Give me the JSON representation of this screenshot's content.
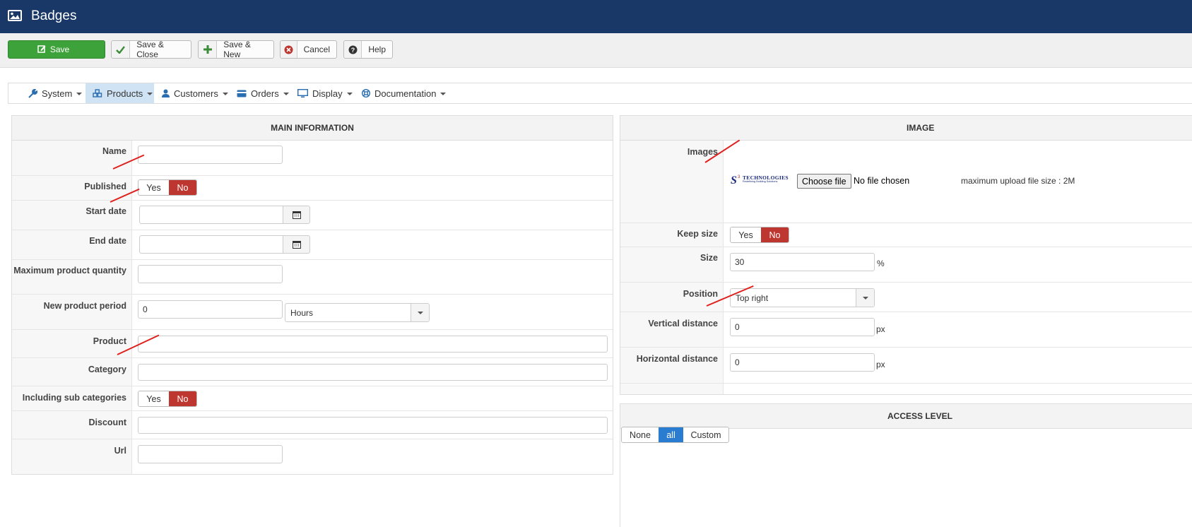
{
  "header": {
    "title": "Badges",
    "icon": "image-icon"
  },
  "toolbar": {
    "save": "Save",
    "save_close": "Save & Close",
    "save_new": "Save & New",
    "cancel": "Cancel",
    "help": "Help"
  },
  "menu": [
    {
      "label": "System",
      "icon": "wrench-icon"
    },
    {
      "label": "Products",
      "icon": "cubes-icon",
      "active": true
    },
    {
      "label": "Customers",
      "icon": "user-icon"
    },
    {
      "label": "Orders",
      "icon": "card-icon"
    },
    {
      "label": "Display",
      "icon": "monitor-icon"
    },
    {
      "label": "Documentation",
      "icon": "lifebuoy-icon"
    }
  ],
  "main": {
    "heading": "MAIN INFORMATION",
    "name_label": "Name",
    "published_label": "Published",
    "start_date_label": "Start date",
    "end_date_label": "End date",
    "max_qty_label": "Maximum product quantity",
    "new_period_label": "New product period",
    "new_period_value": "0",
    "new_period_unit": "Hours",
    "product_label": "Product",
    "category_label": "Category",
    "sub_categories_label": "Including sub categories",
    "discount_label": "Discount",
    "url_label": "Url",
    "yes": "Yes",
    "no": "No"
  },
  "image": {
    "heading": "IMAGE",
    "images_label": "Images",
    "logo_text": "TECHNOLOGIES",
    "logo_tagline": "Redefining Building Solutions",
    "choose_file": "Choose file",
    "no_file": "No file chosen",
    "max_upload": "maximum upload file size : 2M",
    "keep_size_label": "Keep size",
    "size_label": "Size",
    "size_value": "30",
    "size_unit": "%",
    "position_label": "Position",
    "position_value": "Top right",
    "vertical_label": "Vertical distance",
    "vertical_value": "0",
    "horizontal_label": "Horizontal distance",
    "horizontal_value": "0",
    "px": "px"
  },
  "access": {
    "heading": "ACCESS LEVEL",
    "none": "None",
    "all": "all",
    "custom": "Custom"
  },
  "colors": {
    "header": "#1a3867",
    "save": "#3ea23a",
    "no_active": "#bd362f",
    "all_active": "#2a7cd0"
  }
}
